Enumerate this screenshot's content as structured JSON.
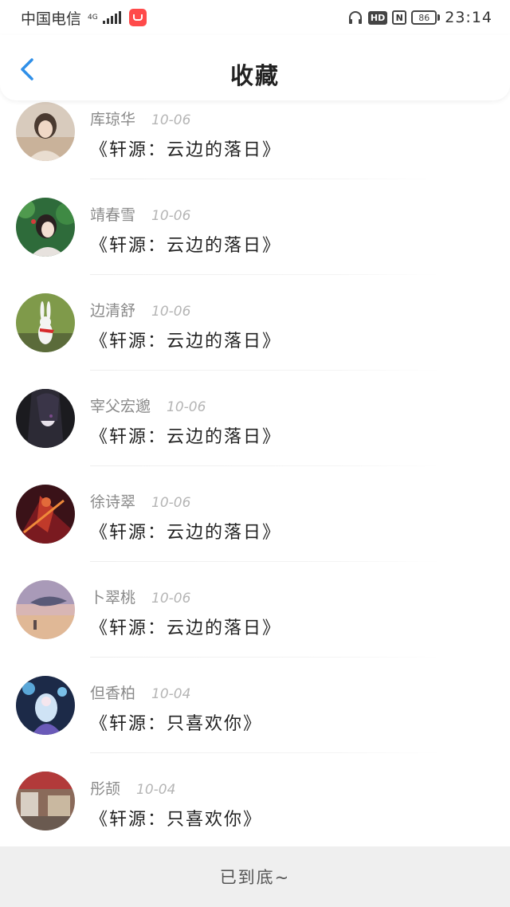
{
  "status_bar": {
    "carrier": "中国电信",
    "network": "4G",
    "hd": "HD",
    "nfc": "N",
    "battery": "86",
    "time": "23:14"
  },
  "header": {
    "title": "收藏"
  },
  "items": [
    {
      "name": "库琼华",
      "date": "10-06",
      "title": "《轩源：云边的落日》"
    },
    {
      "name": "靖春雪",
      "date": "10-06",
      "title": "《轩源：云边的落日》"
    },
    {
      "name": "边清舒",
      "date": "10-06",
      "title": "《轩源：云边的落日》"
    },
    {
      "name": "宰父宏邈",
      "date": "10-06",
      "title": "《轩源：云边的落日》"
    },
    {
      "name": "徐诗翠",
      "date": "10-06",
      "title": "《轩源：云边的落日》"
    },
    {
      "name": "卜翠桃",
      "date": "10-06",
      "title": "《轩源：云边的落日》"
    },
    {
      "name": "但香柏",
      "date": "10-04",
      "title": "《轩源：只喜欢你》"
    },
    {
      "name": "彤颉",
      "date": "10-04",
      "title": "《轩源：只喜欢你》"
    }
  ],
  "footer": {
    "text": "已到底~"
  },
  "colors": {
    "accent": "#2f8fe8",
    "footer_bg": "#efefef"
  }
}
